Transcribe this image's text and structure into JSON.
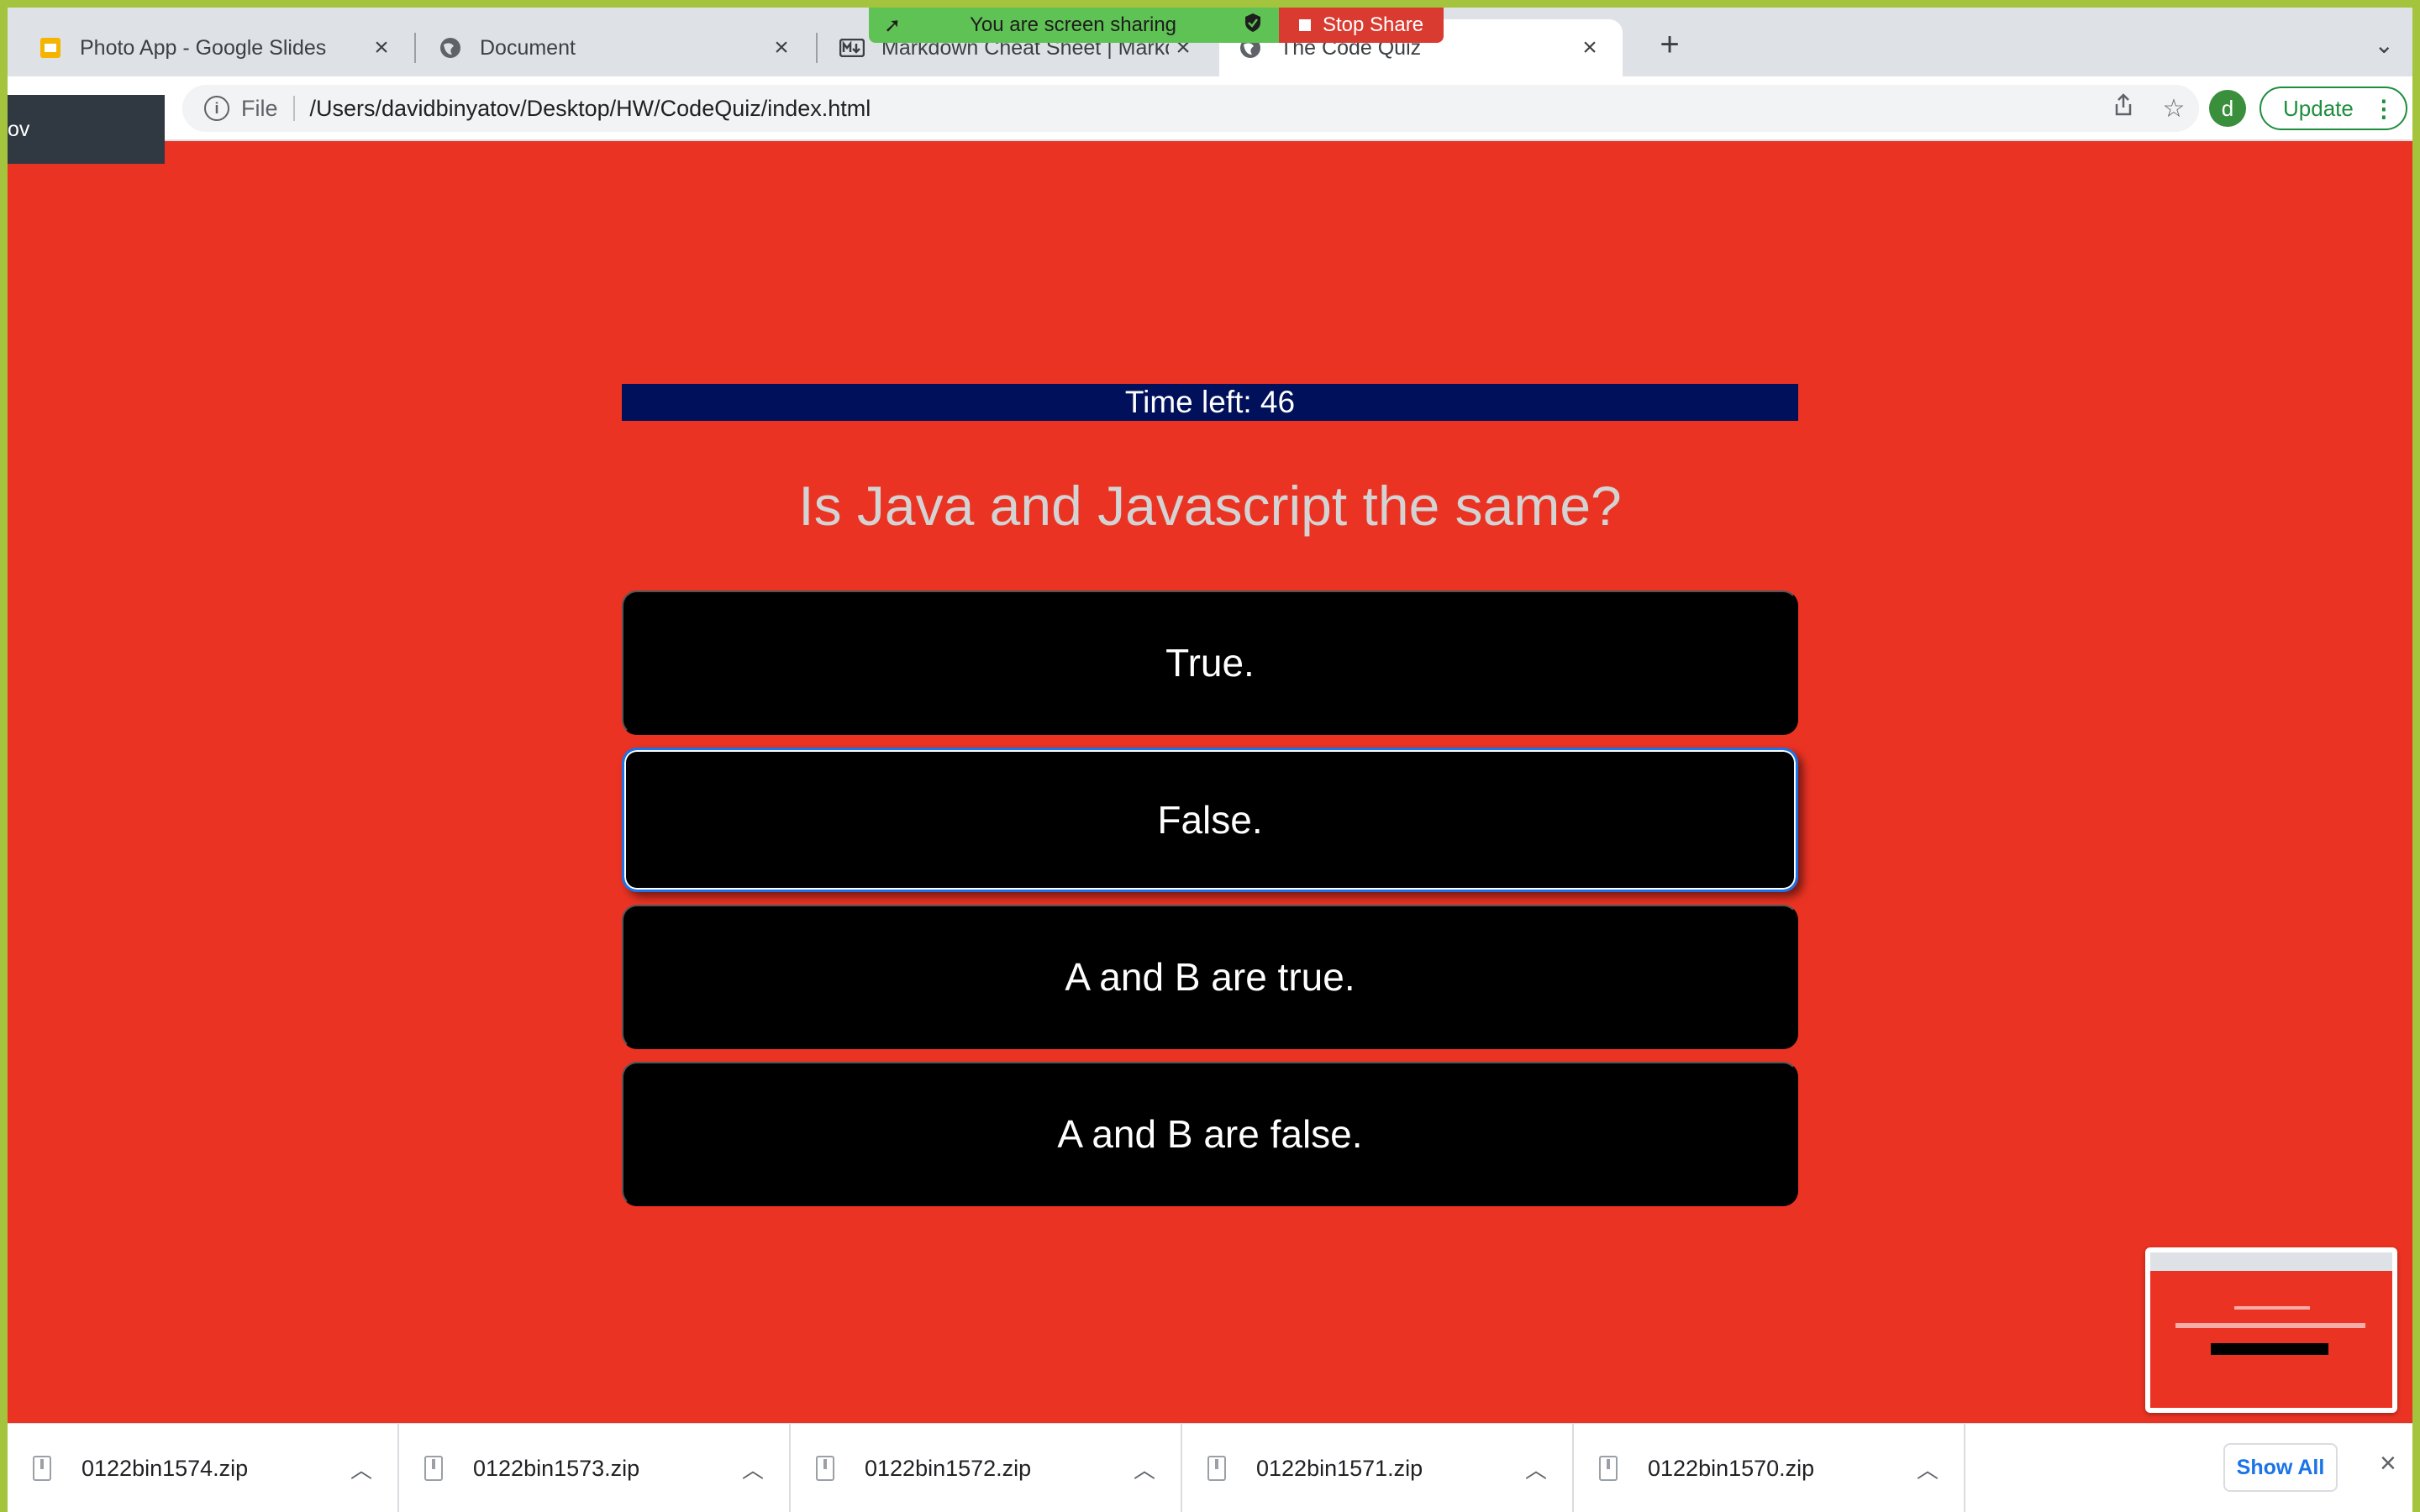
{
  "browser": {
    "tabs": [
      {
        "title": "Photo App - Google Slides",
        "icon": "google-slides-icon"
      },
      {
        "title": "Document",
        "icon": "globe-icon"
      },
      {
        "title": "Markdown Cheat Sheet | Markd",
        "icon": "markdown-icon"
      },
      {
        "title": "The Code Quiz",
        "icon": "globe-icon"
      }
    ],
    "new_tab": "+",
    "tab_menu": "⌄",
    "share_banner": {
      "text": "You are screen sharing",
      "stop_label": "Stop Share"
    },
    "address": {
      "scheme_label": "File",
      "url": "/Users/davidbinyatov/Desktop/HW/CodeQuiz/index.html"
    },
    "profile_initial": "d",
    "update_label": "Update",
    "tooltip_fragment": "ov"
  },
  "quiz": {
    "timer_text": "Time left: 46",
    "question": "Is Java and Javascript the same?",
    "answers": [
      "True.",
      "False.",
      "A and B are true.",
      "A and B are false."
    ]
  },
  "downloads": {
    "files": [
      "0122bin1574.zip",
      "0122bin1573.zip",
      "0122bin1572.zip",
      "0122bin1571.zip",
      "0122bin1570.zip"
    ],
    "show_all_label": "Show All"
  },
  "colors": {
    "page_background": "#eb3323",
    "timer_background": "#00105a",
    "answer_background": "#000000",
    "share_green": "#5fc254",
    "share_red": "#d93b30",
    "outer_border": "#a4c43e"
  }
}
